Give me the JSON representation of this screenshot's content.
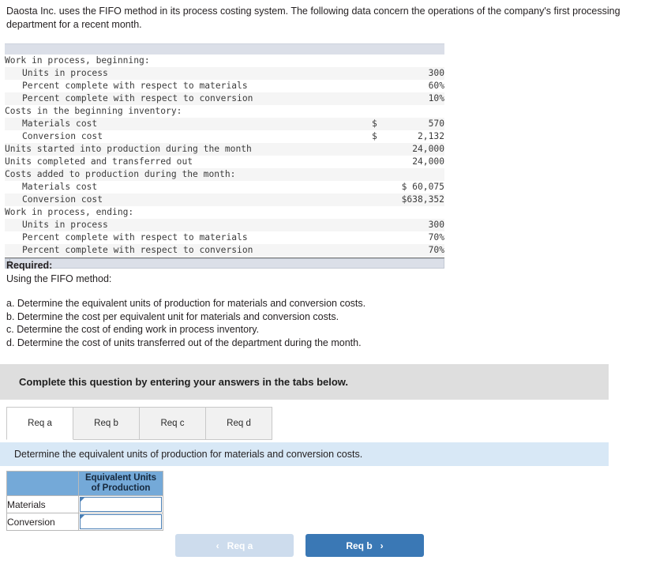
{
  "intro": "Daosta Inc. uses the FIFO method in its process costing system. The following data concern the operations of the company's first processing department for a recent month.",
  "exhibit": {
    "rows": [
      {
        "label": "Work in process, beginning:",
        "indent": 0,
        "currency": "",
        "value": ""
      },
      {
        "label": "Units in process",
        "indent": 1,
        "currency": "",
        "value": "300"
      },
      {
        "label": "Percent complete with respect to materials",
        "indent": 1,
        "currency": "",
        "value": "60%"
      },
      {
        "label": "Percent complete with respect to conversion",
        "indent": 1,
        "currency": "",
        "value": "10%"
      },
      {
        "label": "Costs in the beginning inventory:",
        "indent": 0,
        "currency": "",
        "value": ""
      },
      {
        "label": "Materials cost",
        "indent": 1,
        "currency": "$",
        "value": "570"
      },
      {
        "label": "Conversion cost",
        "indent": 1,
        "currency": "$",
        "value": "2,132"
      },
      {
        "label": "Units started into production during the month",
        "indent": 0,
        "currency": "",
        "value": "24,000"
      },
      {
        "label": "Units completed and transferred out",
        "indent": 0,
        "currency": "",
        "value": "24,000"
      },
      {
        "label": "Costs added to production during the month:",
        "indent": 0,
        "currency": "",
        "value": ""
      },
      {
        "label": "Materials cost",
        "indent": 1,
        "currency": "",
        "value": "$ 60,075"
      },
      {
        "label": "Conversion cost",
        "indent": 1,
        "currency": "",
        "value": "$638,352"
      },
      {
        "label": "Work in process, ending:",
        "indent": 0,
        "currency": "",
        "value": ""
      },
      {
        "label": "Units in process",
        "indent": 1,
        "currency": "",
        "value": "300"
      },
      {
        "label": "Percent complete with respect to materials",
        "indent": 1,
        "currency": "",
        "value": "70%"
      },
      {
        "label": "Percent complete with respect to conversion",
        "indent": 1,
        "currency": "",
        "value": "70%"
      }
    ]
  },
  "required": {
    "heading": "Required:",
    "subheading": "Using the FIFO method:",
    "items": [
      "a. Determine the equivalent units of production for materials and conversion costs.",
      "b. Determine the cost per equivalent unit for materials and conversion costs.",
      "c. Determine the cost of ending work in process inventory.",
      "d. Determine the cost of units transferred out of the department during the month."
    ]
  },
  "banner": {
    "text": "Complete this question by entering your answers in the tabs below."
  },
  "tabs": [
    {
      "label": "Req a",
      "active": true
    },
    {
      "label": "Req b",
      "active": false
    },
    {
      "label": "Req c",
      "active": false
    },
    {
      "label": "Req d",
      "active": false
    }
  ],
  "instruction": {
    "text": "Determine the equivalent units of production for materials and conversion costs."
  },
  "answer_table": {
    "header_blank": "",
    "header_label": "Equivalent Units of Production",
    "header_label_line1": "Equivalent Units",
    "header_label_line2": "of Production",
    "rows": [
      {
        "label": "Materials",
        "value": ""
      },
      {
        "label": "Conversion",
        "value": ""
      }
    ]
  },
  "nav": {
    "prev_label": "Req a",
    "prev_chevron": "‹",
    "next_label": "Req b",
    "next_chevron": "›",
    "prev_enabled": false,
    "next_enabled": true
  },
  "colors": {
    "accent_blue": "#3a78b5",
    "accent_blue_disabled": "#cddced",
    "table_header_blue": "#74a9d8",
    "instruction_blue": "#d8e8f6",
    "banner_grey": "#dedede"
  }
}
